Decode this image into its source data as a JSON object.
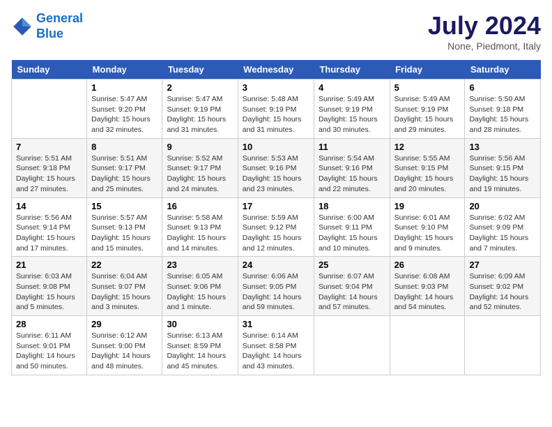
{
  "header": {
    "logo_line1": "General",
    "logo_line2": "Blue",
    "month": "July 2024",
    "location": "None, Piedmont, Italy"
  },
  "weekdays": [
    "Sunday",
    "Monday",
    "Tuesday",
    "Wednesday",
    "Thursday",
    "Friday",
    "Saturday"
  ],
  "weeks": [
    [
      {
        "day": "",
        "info": ""
      },
      {
        "day": "1",
        "info": "Sunrise: 5:47 AM\nSunset: 9:20 PM\nDaylight: 15 hours\nand 32 minutes."
      },
      {
        "day": "2",
        "info": "Sunrise: 5:47 AM\nSunset: 9:19 PM\nDaylight: 15 hours\nand 31 minutes."
      },
      {
        "day": "3",
        "info": "Sunrise: 5:48 AM\nSunset: 9:19 PM\nDaylight: 15 hours\nand 31 minutes."
      },
      {
        "day": "4",
        "info": "Sunrise: 5:49 AM\nSunset: 9:19 PM\nDaylight: 15 hours\nand 30 minutes."
      },
      {
        "day": "5",
        "info": "Sunrise: 5:49 AM\nSunset: 9:19 PM\nDaylight: 15 hours\nand 29 minutes."
      },
      {
        "day": "6",
        "info": "Sunrise: 5:50 AM\nSunset: 9:18 PM\nDaylight: 15 hours\nand 28 minutes."
      }
    ],
    [
      {
        "day": "7",
        "info": "Sunrise: 5:51 AM\nSunset: 9:18 PM\nDaylight: 15 hours\nand 27 minutes."
      },
      {
        "day": "8",
        "info": "Sunrise: 5:51 AM\nSunset: 9:17 PM\nDaylight: 15 hours\nand 25 minutes."
      },
      {
        "day": "9",
        "info": "Sunrise: 5:52 AM\nSunset: 9:17 PM\nDaylight: 15 hours\nand 24 minutes."
      },
      {
        "day": "10",
        "info": "Sunrise: 5:53 AM\nSunset: 9:16 PM\nDaylight: 15 hours\nand 23 minutes."
      },
      {
        "day": "11",
        "info": "Sunrise: 5:54 AM\nSunset: 9:16 PM\nDaylight: 15 hours\nand 22 minutes."
      },
      {
        "day": "12",
        "info": "Sunrise: 5:55 AM\nSunset: 9:15 PM\nDaylight: 15 hours\nand 20 minutes."
      },
      {
        "day": "13",
        "info": "Sunrise: 5:56 AM\nSunset: 9:15 PM\nDaylight: 15 hours\nand 19 minutes."
      }
    ],
    [
      {
        "day": "14",
        "info": "Sunrise: 5:56 AM\nSunset: 9:14 PM\nDaylight: 15 hours\nand 17 minutes."
      },
      {
        "day": "15",
        "info": "Sunrise: 5:57 AM\nSunset: 9:13 PM\nDaylight: 15 hours\nand 15 minutes."
      },
      {
        "day": "16",
        "info": "Sunrise: 5:58 AM\nSunset: 9:13 PM\nDaylight: 15 hours\nand 14 minutes."
      },
      {
        "day": "17",
        "info": "Sunrise: 5:59 AM\nSunset: 9:12 PM\nDaylight: 15 hours\nand 12 minutes."
      },
      {
        "day": "18",
        "info": "Sunrise: 6:00 AM\nSunset: 9:11 PM\nDaylight: 15 hours\nand 10 minutes."
      },
      {
        "day": "19",
        "info": "Sunrise: 6:01 AM\nSunset: 9:10 PM\nDaylight: 15 hours\nand 9 minutes."
      },
      {
        "day": "20",
        "info": "Sunrise: 6:02 AM\nSunset: 9:09 PM\nDaylight: 15 hours\nand 7 minutes."
      }
    ],
    [
      {
        "day": "21",
        "info": "Sunrise: 6:03 AM\nSunset: 9:08 PM\nDaylight: 15 hours\nand 5 minutes."
      },
      {
        "day": "22",
        "info": "Sunrise: 6:04 AM\nSunset: 9:07 PM\nDaylight: 15 hours\nand 3 minutes."
      },
      {
        "day": "23",
        "info": "Sunrise: 6:05 AM\nSunset: 9:06 PM\nDaylight: 15 hours\nand 1 minute."
      },
      {
        "day": "24",
        "info": "Sunrise: 6:06 AM\nSunset: 9:05 PM\nDaylight: 14 hours\nand 59 minutes."
      },
      {
        "day": "25",
        "info": "Sunrise: 6:07 AM\nSunset: 9:04 PM\nDaylight: 14 hours\nand 57 minutes."
      },
      {
        "day": "26",
        "info": "Sunrise: 6:08 AM\nSunset: 9:03 PM\nDaylight: 14 hours\nand 54 minutes."
      },
      {
        "day": "27",
        "info": "Sunrise: 6:09 AM\nSunset: 9:02 PM\nDaylight: 14 hours\nand 52 minutes."
      }
    ],
    [
      {
        "day": "28",
        "info": "Sunrise: 6:11 AM\nSunset: 9:01 PM\nDaylight: 14 hours\nand 50 minutes."
      },
      {
        "day": "29",
        "info": "Sunrise: 6:12 AM\nSunset: 9:00 PM\nDaylight: 14 hours\nand 48 minutes."
      },
      {
        "day": "30",
        "info": "Sunrise: 6:13 AM\nSunset: 8:59 PM\nDaylight: 14 hours\nand 45 minutes."
      },
      {
        "day": "31",
        "info": "Sunrise: 6:14 AM\nSunset: 8:58 PM\nDaylight: 14 hours\nand 43 minutes."
      },
      {
        "day": "",
        "info": ""
      },
      {
        "day": "",
        "info": ""
      },
      {
        "day": "",
        "info": ""
      }
    ]
  ]
}
